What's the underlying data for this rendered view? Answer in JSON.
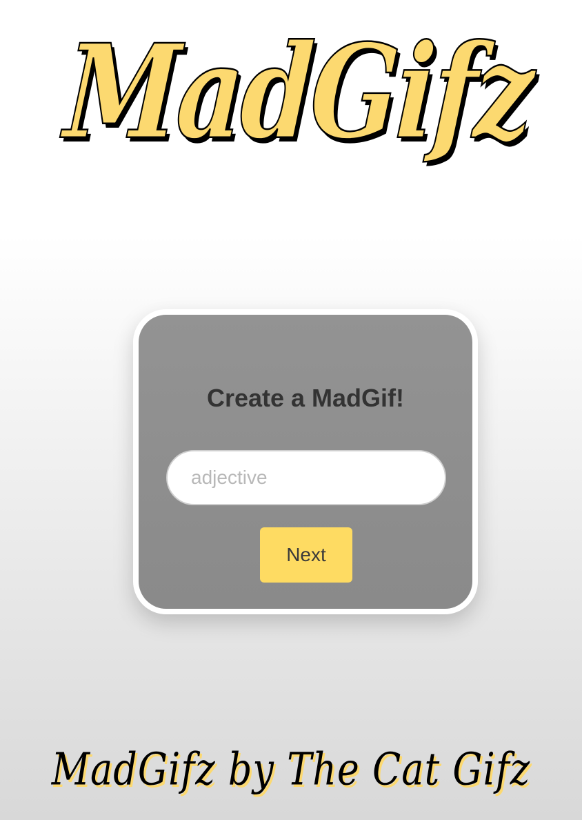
{
  "header": {
    "logo_text": "MadGifz"
  },
  "card": {
    "title": "Create a MadGif!",
    "input_placeholder": "adjective",
    "input_value": "",
    "next_label": "Next"
  },
  "footer": {
    "text": "MadGifz by The Cat Gifz"
  },
  "colors": {
    "brand_yellow": "#fcd970",
    "button_yellow": "#fedb62",
    "card_gray": "#8f8f8f"
  }
}
